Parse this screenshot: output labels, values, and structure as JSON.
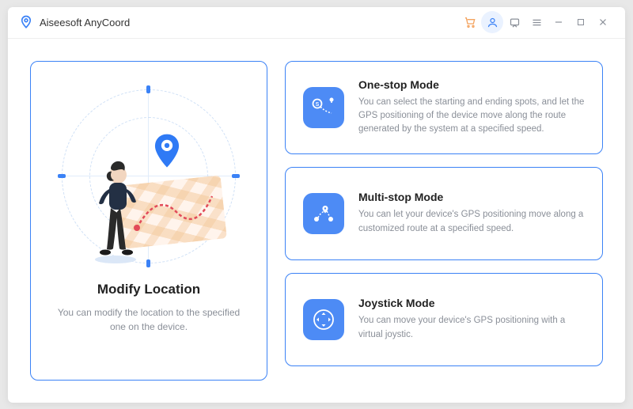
{
  "app": {
    "title": "Aiseesoft AnyCoord"
  },
  "left": {
    "title": "Modify Location",
    "desc": "You can modify the location to the specified one on the device."
  },
  "modes": [
    {
      "icon": "onestop-icon",
      "title": "One-stop Mode",
      "desc": "You can select the starting and ending spots, and let the GPS positioning of the device move along the route generated by the system at a specified speed."
    },
    {
      "icon": "multistop-icon",
      "title": "Multi-stop Mode",
      "desc": "You can let your device's GPS positioning move along a customized route at a specified speed."
    },
    {
      "icon": "joystick-icon",
      "title": "Joystick Mode",
      "desc": "You can move your device's GPS positioning with a virtual joystic."
    }
  ]
}
